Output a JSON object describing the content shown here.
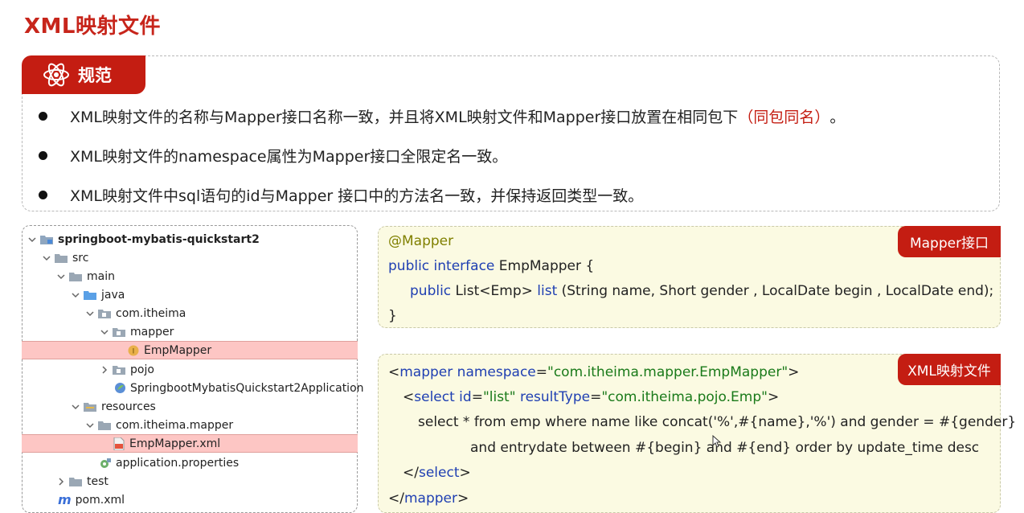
{
  "page": {
    "title": "XML映射文件"
  },
  "spec": {
    "tag": "规范",
    "bullets": [
      {
        "pre": "XML映射文件的名称与Mapper接口名称一致，并且将XML映射文件和Mapper接口放置在相同包下",
        "red": "（同包同名）",
        "post": "。"
      },
      {
        "pre": "XML映射文件的namespace属性为Mapper接口全限定名一致。",
        "red": "",
        "post": ""
      },
      {
        "pre": "XML映射文件中sql语句的id与Mapper 接口中的方法名一致，并保持返回类型一致。",
        "red": "",
        "post": ""
      }
    ]
  },
  "tree": {
    "items": [
      {
        "label": "springboot-mybatis-quickstart2",
        "icon": "module-folder-icon"
      },
      {
        "label": "src",
        "icon": "folder-icon"
      },
      {
        "label": "main",
        "icon": "folder-icon"
      },
      {
        "label": "java",
        "icon": "source-folder-icon"
      },
      {
        "label": "com.itheima",
        "icon": "package-icon"
      },
      {
        "label": "mapper",
        "icon": "package-icon"
      },
      {
        "label": "EmpMapper",
        "icon": "interface-icon",
        "badge": "I"
      },
      {
        "label": "pojo",
        "icon": "package-icon"
      },
      {
        "label": "SpringbootMybatisQuickstart2Application",
        "icon": "spring-class-icon"
      },
      {
        "label": "resources",
        "icon": "resources-folder-icon"
      },
      {
        "label": "com.itheima.mapper",
        "icon": "folder-icon"
      },
      {
        "label": "EmpMapper.xml",
        "icon": "xml-file-icon"
      },
      {
        "label": "application.properties",
        "icon": "properties-file-icon"
      },
      {
        "label": "test",
        "icon": "folder-icon"
      },
      {
        "label": "pom.xml",
        "icon": "maven-icon",
        "badge": "m"
      }
    ]
  },
  "mapper_interface": {
    "tag": "Mapper接口",
    "annotation": "@Mapper",
    "l2_kw": "public interface",
    "l2_rest": " EmpMapper {",
    "l3_kw": "public",
    "l3_type": " List<Emp> ",
    "l3_method": "list",
    "l3_rest": " (String name, Short gender , LocalDate begin , LocalDate end);",
    "l4": "}"
  },
  "xml_file": {
    "tag": "XML映射文件",
    "l1": {
      "open": "<",
      "tag": "mapper",
      "attr": " namespace",
      "eq": "=",
      "val": "\"com.itheima.mapper.EmpMapper\"",
      "close": ">"
    },
    "l2": {
      "open": "<",
      "tag": "select",
      "attr1": " id",
      "eq1": "=",
      "val1": "\"list\"",
      "attr2": " resultType",
      "eq2": "=",
      "val2": "\"com.itheima.pojo.Emp\"",
      "close": ">"
    },
    "l3": "select * from emp where name like concat('%',#{name},'%') and gender = #{gender}",
    "l4": "and entrydate between #{begin} and #{end} order by update_time desc",
    "l5": {
      "open": "</",
      "tag": "select",
      "close": ">"
    },
    "l6": {
      "open": "</",
      "tag": "mapper",
      "close": ">"
    }
  },
  "colors": {
    "accent": "#c41d12",
    "code_bg": "#fbfae2",
    "highlight": "#fdc6c4"
  }
}
